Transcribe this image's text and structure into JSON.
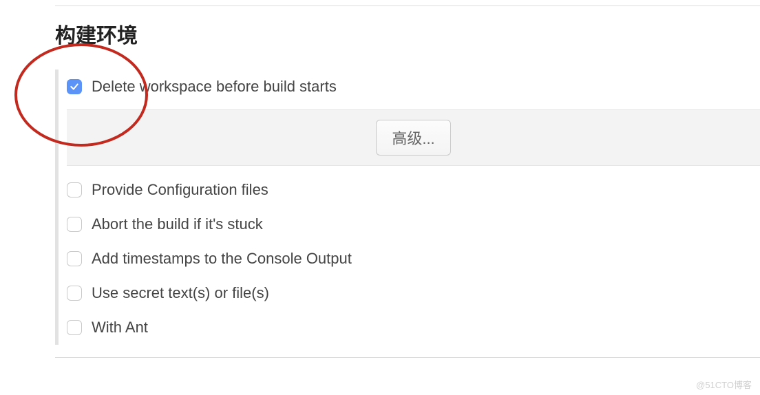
{
  "section": {
    "title": "构建环境"
  },
  "options": [
    {
      "label": "Delete workspace before build starts",
      "checked": true
    },
    {
      "label": "Provide Configuration files",
      "checked": false
    },
    {
      "label": "Abort the build if it's stuck",
      "checked": false
    },
    {
      "label": "Add timestamps to the Console Output",
      "checked": false
    },
    {
      "label": "Use secret text(s) or file(s)",
      "checked": false
    },
    {
      "label": "With Ant",
      "checked": false
    }
  ],
  "advanced": {
    "label": "高级..."
  },
  "watermark": "@51CTO博客"
}
